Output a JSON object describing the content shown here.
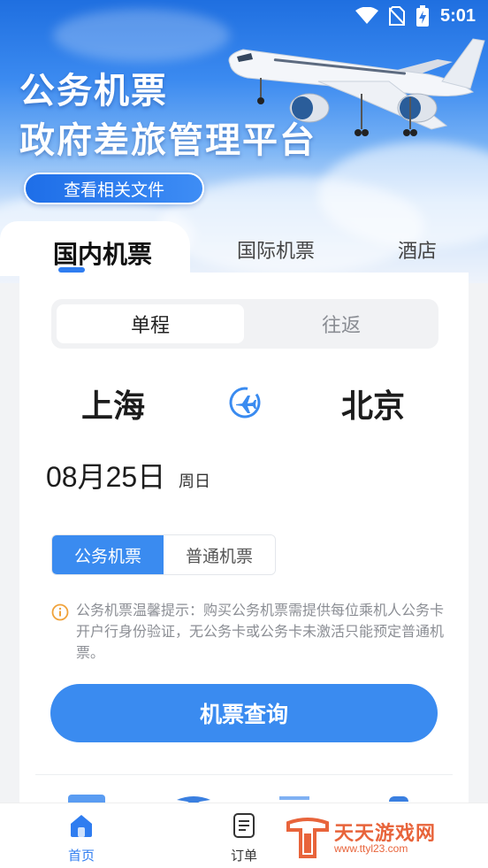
{
  "status_bar": {
    "time": "5:01"
  },
  "hero": {
    "title_line1": "公务机票",
    "title_line2": "政府差旅管理平台",
    "docs_button": "查看相关文件"
  },
  "tabs": [
    {
      "label": "国内机票",
      "active": true
    },
    {
      "label": "国际机票",
      "active": false
    },
    {
      "label": "酒店",
      "active": false
    }
  ],
  "trip_type": {
    "one_way": "单程",
    "round_trip": "往返",
    "selected": "单程"
  },
  "route": {
    "from": "上海",
    "to": "北京",
    "swap_icon": "plane-swap-icon"
  },
  "date": {
    "value": "08月25日",
    "weekday": "周日"
  },
  "ticket_type": {
    "official": "公务机票",
    "regular": "普通机票",
    "selected": "公务机票"
  },
  "tip": "公务机票温馨提示：购买公务机票需提供每位乘机人公务卡开户行身份验证，无公务卡或公务卡未激活只能预定普通机票。",
  "search_button": "机票查询",
  "bottom_nav": {
    "home": "首页",
    "orders": "订单"
  },
  "watermark": {
    "title": "天天游戏网",
    "url": "www.ttyl23.com"
  },
  "colors": {
    "accent": "#3a8bf0",
    "watermark": "#e8643b"
  }
}
